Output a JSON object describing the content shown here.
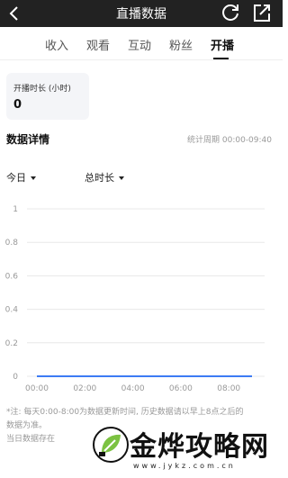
{
  "header": {
    "title": "直播数据",
    "back_icon": "back-arrow-icon",
    "refresh_icon": "refresh-icon",
    "share_icon": "share-icon",
    "background_color": "#222222"
  },
  "tabs": [
    {
      "label": "收入",
      "active": false
    },
    {
      "label": "观看",
      "active": false
    },
    {
      "label": "互动",
      "active": false
    },
    {
      "label": "粉丝",
      "active": false
    },
    {
      "label": "开播",
      "active": true
    }
  ],
  "metric_card": {
    "label": "开播时长 (小时)",
    "value": "0"
  },
  "section": {
    "title": "数据详情",
    "period": "统计周期 00:00-09:40"
  },
  "filters": {
    "date": "今日",
    "metric": "总时长"
  },
  "chart_data": {
    "type": "line",
    "x": [
      "00:00",
      "02:00",
      "04:00",
      "06:00",
      "08:00"
    ],
    "y_ticks": [
      "1",
      "0.8",
      "0.6",
      "0.4",
      "0.2",
      "0"
    ],
    "ylim": [
      0,
      1
    ],
    "series": [
      {
        "values": [
          0,
          0,
          0,
          0,
          0
        ],
        "color": "#3d7bf4"
      }
    ],
    "grid": true
  },
  "note": {
    "line1": "*注: 每天0:00-8:00为数据更新时间, 历史数据请以早上8点之后的",
    "line2": "数据为准。",
    "line3": "当日数据存在"
  },
  "watermark": {
    "text": "金烨攻略网",
    "url": "www.jykz.com.cn"
  }
}
